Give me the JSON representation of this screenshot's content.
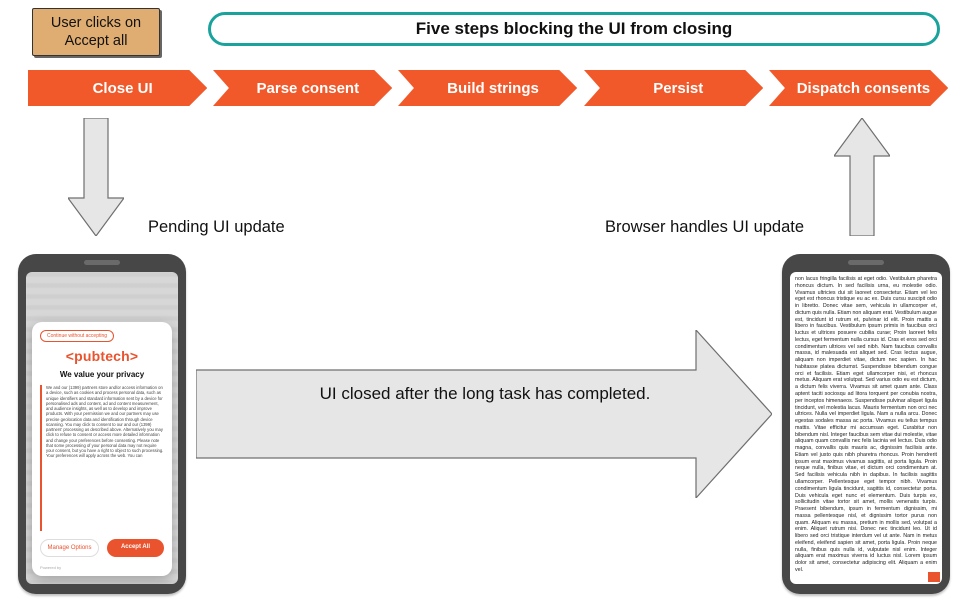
{
  "user_action": "User clicks on Accept all",
  "headline": "Five steps blocking the UI from closing",
  "steps": [
    {
      "label": "Close UI"
    },
    {
      "label": "Parse consent"
    },
    {
      "label": "Build strings"
    },
    {
      "label": "Persist"
    },
    {
      "label": "Dispatch consents"
    }
  ],
  "labels": {
    "pending": "Pending UI update",
    "browser_handles": "Browser handles UI update",
    "center": "UI closed after the long task has completed."
  },
  "colors": {
    "step_fill": "#f1592a",
    "pill_border": "#1aa39c",
    "user_box_bg": "#dfad71",
    "arrow_fill": "#e6e6e6",
    "arrow_stroke": "#6f6f6f"
  },
  "consent_modal": {
    "continue_without_accepting": "Continue without accepting",
    "logo_text": "<pubtech>",
    "headline": "We value your privacy",
    "body": "We and our (1399) partners store and/or access information on a device, such as cookies and process personal data, such as unique identifiers and standard information sent by a device for personalised ads and content, ad and content measurement, and audience insights, as well as to develop and improve products. With your permission we and our partners may use precise geolocation data and identification through device scanning. You may click to consent to our and our (1399) partners' processing as described above. Alternatively you may click to refuse to consent or access more detailed information and change your preferences before consenting. Please note that some processing of your personal data may not require your consent, but you have a right to object to such processing. Your preferences will apply across the web. You can",
    "manage_label": "Manage Options",
    "accept_label": "Accept All",
    "powered": "Powered by"
  },
  "article_text": "non lacus fringilla facilisis at eget odio. Vestibulum pharetra rhoncus dictum. In sed facilisis urna, eu molestie odio. Vivamus ultricies dui sit laoreet consectetur. Etiam vel leo eget est rhoncus tristique eu ac ex. Duis cursu suscipit odio in libretto. Donec vitae sem, vehicula in ullamcorper et, dictum quis nulla. Etiam non aliquam erat. Vestibulum augue est, tincidunt id rutrum et, pulvinar id elit. Proin mattis a libero in faucibus. Vestibulum ipsum primis in faucibus orci luctus et ultrices posuere cubilia curae; Proin laoreet felis lectus, eget fermentum nulla cursus id. Cras et eros sed orci condimentum ultrices vel sed nibh. Nam faucibus convallis massa, id malesuada est aliquet sed. Cras lectus augue, aliquam non imperdiet vitae, dictum nec sapien. In hac habitasse platea dictumst. Suspendisse bibendum congue orci et facilisis. Etiam eget ullamcorper nisi, et rhoncus metus. Aliquam erat volutpat. Sed varius odio eu est dictum, a dictum felis viverra. Vivamus sit amet quam ante. Class aptent taciti sociosqu ad litora torquent per conubia nostra, per inceptos himenaeos. Suspendisse pulvinar aliquet ligula tincidunt, vel molestia lacus. Mauris fermentum non orci nec ultrices. Nulla vel imperdiet ligula. Nam a nulla arcu. Donec egestas sodales massa ac porta. Vivamus eu tellus tempus mattis. Vitae efficitur mi accumsan eget. Curabitur non bibendum nisl. Integer faucibus sem vitae dui molestie, vitae aliquam quam convallis nec felis lacinia vel lectus. Duis odio magna, convallis quis mauris ac, dignissim facilisis ante. Etiam vel justo quis nibh pharetra rhoncus. Proin hendrerit ipsum erat maximus vivamus sagittis, at porta ligula. Proin neque nulla, finibus vitae, et dictum orci condimentum at. Sed facilisis vehicula nibh in dapibus. In facilisis sagittis ullamcorper. Pellentesque eget tempor nibh. Vivamus condimentum ligula tincidunt, sagittis id, consectetur porta. Duis vehicula eget nunc et elementum. Duis turpis ex, sollicitudin vitae tortor sit amet, mollis venenatis turpis. Praesent bibendum, ipsum in fermentum dignissim, mi massa pellentesque nisl, et dignissim tortor purus non quam. Aliquam eu massa, pretium in mollis sed, volutpat a enim. Aliquet rutrum nisi. Donec nec tincidunt leo. Ut id libero sed orci tristique interdum vel ut ante. Nam in metus eleifend, eleifend sapien sit amet, porta ligula. Proin neque nulla, finibus quis nulla id, vulputate nisl enim. Integer aliquam erat maximus viverra id luctus nisl. Lorem ipsum dolor sit amet, consectetur adipiscing elit. Aliquam a enim vel."
}
